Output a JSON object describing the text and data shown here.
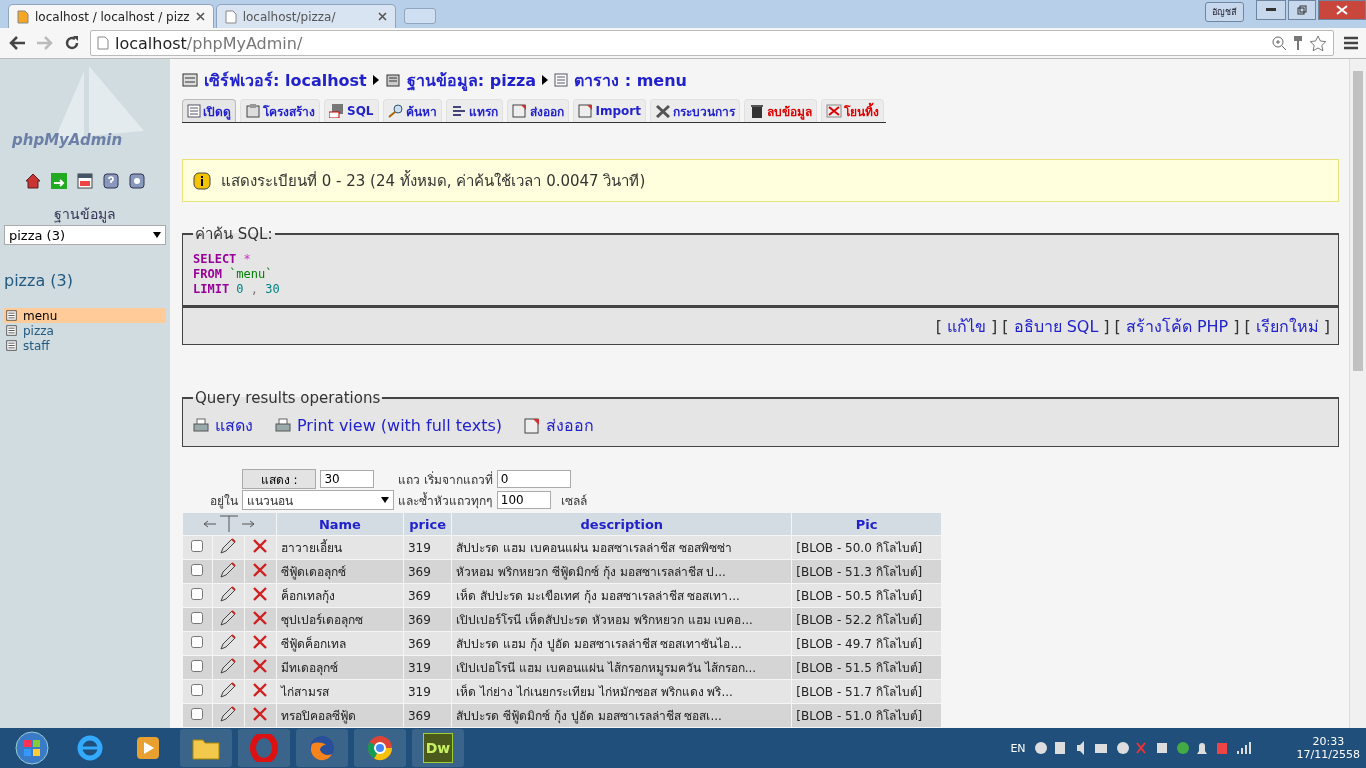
{
  "browser": {
    "tabs": [
      {
        "title": "localhost / localhost / pizz",
        "selected": true
      },
      {
        "title": "localhost/pizza/",
        "selected": false
      }
    ],
    "user_button": "อัญชลี",
    "address": {
      "host": "localhost",
      "path": "/phpMyAdmin/"
    }
  },
  "sidebar": {
    "logo": "phpMyAdmin",
    "db_label": "ฐานข้อมูล",
    "db_select": "pizza (3)",
    "db_title": "pizza (3)",
    "tables": [
      {
        "name": "menu",
        "selected": true
      },
      {
        "name": "pizza",
        "selected": false
      },
      {
        "name": "staff",
        "selected": false
      }
    ]
  },
  "breadcrumb": [
    "เซิร์ฟเวอร์: localhost",
    "ฐานข้อมูล: pizza",
    "ตาราง : menu"
  ],
  "tabs": [
    {
      "label": "เปิดดู",
      "selected": true,
      "danger": false
    },
    {
      "label": "โครงสร้าง",
      "selected": false,
      "danger": false
    },
    {
      "label": "SQL",
      "selected": false,
      "danger": false
    },
    {
      "label": "ค้นหา",
      "selected": false,
      "danger": false
    },
    {
      "label": "แทรก",
      "selected": false,
      "danger": false
    },
    {
      "label": "ส่งออก",
      "selected": false,
      "danger": false
    },
    {
      "label": "Import",
      "selected": false,
      "danger": false
    },
    {
      "label": "กระบวนการ",
      "selected": false,
      "danger": false
    },
    {
      "label": "ลบข้อมูล",
      "selected": false,
      "danger": true
    },
    {
      "label": "โยนทิ้ง",
      "selected": false,
      "danger": true
    }
  ],
  "notice": "แสดงระเบียนที่ 0 - 23 (24 ทั้งหมด, ค่าค้นใช้เวลา 0.0047 วินาที)",
  "sql": {
    "legend": "ค่าค้น SQL:",
    "lines": [
      [
        {
          "text": "SELECT",
          "kind": "keyword"
        },
        {
          "text": "*",
          "kind": "operator"
        }
      ],
      [
        {
          "text": "FROM",
          "kind": "keyword"
        },
        {
          "text": "`menu`",
          "kind": "string"
        }
      ],
      [
        {
          "text": "LIMIT",
          "kind": "keyword"
        },
        {
          "text": "0",
          "kind": "number"
        },
        {
          "text": ",",
          "kind": "punct"
        },
        {
          "text": "30",
          "kind": "number"
        }
      ]
    ],
    "brackets": [
      "[",
      "]"
    ],
    "links": [
      "แก้ไข",
      "อธิบาย SQL",
      "สร้างโค้ด PHP",
      "เรียกใหม่"
    ]
  },
  "query_ops": {
    "legend": "Query results operations",
    "items": [
      "แสดง",
      "Print view (with full texts)",
      "ส่งออก"
    ]
  },
  "nav": {
    "show_button": "แสดง :",
    "rows_value": "30",
    "start_label": "แถว เริ่มจากแถวที่",
    "start_value": "0",
    "mode_label": "อยู่ใน",
    "mode_value": "แนวนอน",
    "repeat_label": "และซ้ำหัวแถวทุกๆ",
    "repeat_value": "100",
    "cells_label": "เซลล์"
  },
  "table": {
    "columns": [
      "Name",
      "price",
      "description",
      "Pic"
    ],
    "rows": [
      {
        "checked": false,
        "cells": [
          "ฮาวายเอี้ยน",
          "319",
          "สัปปะรด แฮม เบคอนแผ่น มอสซาเรลล่าชีส ซอสพิซซ่า",
          "[BLOB - 50.0 กิโลไบต์]"
        ]
      },
      {
        "checked": false,
        "cells": [
          "ซีฟู้ดเดอลุกซ์",
          "369",
          "หัวหอม พริกหยวก ซีฟู้ดมิกซ์ กุ้ง มอสซาเรลล่าชีส  ป...",
          "[BLOB - 51.3 กิโลไบต์]"
        ]
      },
      {
        "checked": false,
        "cells": [
          "ค็อกเทลกุ้ง",
          "369",
          "เห็ด สัปปะรด มะเขือเทศ กุ้ง มอสซาเรลล่าชีส ซอสเทา...",
          "[BLOB - 50.5 กิโลไบต์]"
        ]
      },
      {
        "checked": false,
        "cells": [
          "ซุปเปอร์เดอลุกซ",
          "369",
          "เปิปเปอร์โรนี เห็ดสัปปะรด หัวหอม พริกหยวก แฮม เบคอ...",
          "[BLOB - 52.2 กิโลไบต์]"
        ]
      },
      {
        "checked": false,
        "cells": [
          "ซีฟู้ดค็อกเทล",
          "369",
          "สัปปะรด แฮม กุ้ง ปูอัด มอสซาเรลล่าชีส  ซอสเทาซันไอ...",
          "[BLOB - 49.7 กิโลไบต์]"
        ]
      },
      {
        "checked": false,
        "cells": [
          "มีทเดอลุกซ์",
          "319",
          "เปิปเปอโรนี แฮม เบคอนแผ่น ไส้กรอกหมูรมควัน ไส้กรอก...",
          "[BLOB - 51.5 กิโลไบต์]"
        ]
      },
      {
        "checked": false,
        "cells": [
          "ไก่สามรส",
          "319",
          "เห็ด ไก่ย่าง ไก่เนยกระเทียม ไก่หมักซอส พริกแดง พริ...",
          "[BLOB - 51.7 กิโลไบต์]"
        ]
      },
      {
        "checked": false,
        "cells": [
          "ทรอปิคอลซีฟู้ด",
          "369",
          "สัปปะรด ซีฟู้ดมิกซ์ กุ้ง ปูอัด มอสซาเรลล่าชีส ซอสเ...",
          "[BLOB - 51.0 กิโลไบต์]"
        ]
      }
    ]
  },
  "taskbar": {
    "language": "EN",
    "time": "20:33",
    "date": "17/11/2558",
    "dw_label": "Dw"
  }
}
